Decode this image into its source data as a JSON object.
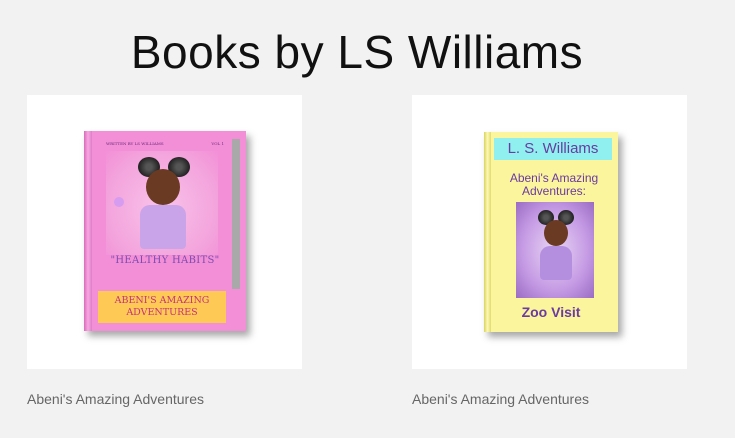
{
  "page": {
    "title": "Books by LS Williams"
  },
  "books": [
    {
      "caption": "Abeni's Amazing Adventures",
      "cover": {
        "top_left_text": "WRITTEN BY LS WILLIAMS",
        "top_right_text": "VOL 1",
        "tagline": "\"HEALTHY HABITS\"",
        "banner_line1": "ABENI'S AMAZING",
        "banner_line2": "ADVENTURES",
        "color": "#f38fd7",
        "banner_color": "#ffc955"
      }
    },
    {
      "caption": "Abeni's Amazing Adventures",
      "cover": {
        "author": "L. S. Williams",
        "title_line1": "Abeni's Amazing",
        "title_line2": "Adventures:",
        "subtitle": "Zoo Visit",
        "color": "#fbf59e",
        "author_box_color": "#8ff0ef",
        "text_color": "#6a3ba1"
      }
    }
  ]
}
